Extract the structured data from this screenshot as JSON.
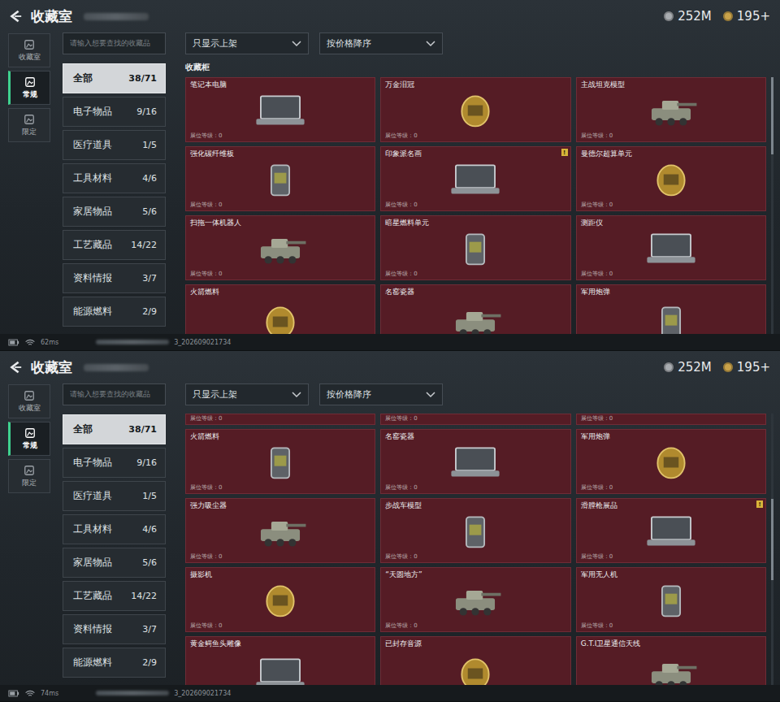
{
  "panels": [
    {
      "header": {
        "title": "收藏室",
        "currency": [
          {
            "amount": "252M",
            "color": "#a8acb0"
          },
          {
            "amount": "195+",
            "color": "#c9a24a"
          }
        ]
      },
      "side_tabs": [
        {
          "label": "收藏室",
          "selected": false
        },
        {
          "label": "常规",
          "selected": true
        },
        {
          "label": "限定",
          "selected": false
        }
      ],
      "search": {
        "placeholder": "请输入想要查找的收藏品"
      },
      "categories": [
        {
          "label": "全部",
          "count": "38/71",
          "selected": true
        },
        {
          "label": "电子物品",
          "count": "9/16",
          "selected": false
        },
        {
          "label": "医疗道具",
          "count": "1/5",
          "selected": false
        },
        {
          "label": "工具材料",
          "count": "4/6",
          "selected": false
        },
        {
          "label": "家居物品",
          "count": "5/6",
          "selected": false
        },
        {
          "label": "工艺藏品",
          "count": "14/22",
          "selected": false
        },
        {
          "label": "资料情报",
          "count": "3/7",
          "selected": false
        },
        {
          "label": "能源燃料",
          "count": "2/9",
          "selected": false
        }
      ],
      "filters": [
        "只显示上架",
        "按价格降序"
      ],
      "section_title": "收藏柜",
      "scrollbar": {
        "level": 0.0
      },
      "cards": [
        {
          "kind": "full",
          "name": "笔记本电脑",
          "level": "展位等级：0"
        },
        {
          "kind": "full",
          "name": "万金泪冠",
          "level": "展位等级：0"
        },
        {
          "kind": "full",
          "name": "主战坦克模型",
          "level": "展位等级：0"
        },
        {
          "kind": "full",
          "name": "强化碳纤维板",
          "level": "展位等级：0"
        },
        {
          "kind": "full",
          "name": "印象派名画",
          "level": "展位等级：0",
          "badge": "!"
        },
        {
          "kind": "full",
          "name": "曼德尔超算单元",
          "level": "展位等级：0"
        },
        {
          "kind": "full",
          "name": "扫拖一体机器人",
          "level": "展位等级：0"
        },
        {
          "kind": "full",
          "name": "暗星燃料单元",
          "level": "展位等级：0"
        },
        {
          "kind": "full",
          "name": "测距仪",
          "level": "展位等级：0"
        },
        {
          "kind": "bottom-cut",
          "name": "火箭燃料"
        },
        {
          "kind": "bottom-cut",
          "name": "名窑瓷器"
        },
        {
          "kind": "bottom-cut",
          "name": "军用炮弹"
        }
      ],
      "status": {
        "ping": "62ms",
        "build": "3_202609021734"
      }
    },
    {
      "header": {
        "title": "收藏室",
        "currency": [
          {
            "amount": "252M",
            "color": "#a8acb0"
          },
          {
            "amount": "195+",
            "color": "#c9a24a"
          }
        ]
      },
      "side_tabs": [
        {
          "label": "收藏室",
          "selected": false
        },
        {
          "label": "常规",
          "selected": true
        },
        {
          "label": "限定",
          "selected": false
        }
      ],
      "search": {
        "placeholder": "请输入想要查找的收藏品"
      },
      "categories": [
        {
          "label": "全部",
          "count": "38/71",
          "selected": true
        },
        {
          "label": "电子物品",
          "count": "9/16",
          "selected": false
        },
        {
          "label": "医疗道具",
          "count": "1/5",
          "selected": false
        },
        {
          "label": "工具材料",
          "count": "4/6",
          "selected": false
        },
        {
          "label": "家居物品",
          "count": "5/6",
          "selected": false
        },
        {
          "label": "工艺藏品",
          "count": "14/22",
          "selected": false
        },
        {
          "label": "资料情报",
          "count": "3/7",
          "selected": false
        },
        {
          "label": "能源燃料",
          "count": "2/9",
          "selected": false
        }
      ],
      "filters": [
        "只显示上架",
        "按价格降序"
      ],
      "scrollbar": {
        "level": 0.45
      },
      "cards": [
        {
          "kind": "top-cut",
          "level": "展位等级：0"
        },
        {
          "kind": "top-cut",
          "level": "展位等级：0"
        },
        {
          "kind": "top-cut",
          "level": "展位等级：0"
        },
        {
          "kind": "full",
          "name": "火箭燃料",
          "level": "展位等级：0"
        },
        {
          "kind": "full",
          "name": "名窑瓷器",
          "level": "展位等级：0"
        },
        {
          "kind": "full",
          "name": "军用炮弹",
          "level": "展位等级：0"
        },
        {
          "kind": "full",
          "name": "强力吸尘器",
          "level": "展位等级：0"
        },
        {
          "kind": "full",
          "name": "步战车模型",
          "level": "展位等级：0"
        },
        {
          "kind": "full",
          "name": "滑膛枪展品",
          "level": "展位等级：0",
          "badge": "!"
        },
        {
          "kind": "full",
          "name": "摄影机",
          "level": "展位等级：0"
        },
        {
          "kind": "full",
          "name": "“天圆地方”",
          "level": "展位等级：0"
        },
        {
          "kind": "full",
          "name": "军用无人机",
          "level": "展位等级：0"
        },
        {
          "kind": "bottom-cut",
          "name": "黄金鳄鱼头雕像"
        },
        {
          "kind": "bottom-cut",
          "name": "已封存音源"
        },
        {
          "kind": "bottom-cut",
          "name": "G.T.I卫星通信天线"
        }
      ],
      "status": {
        "ping": "74ms",
        "build": "3_202609021734"
      }
    }
  ]
}
